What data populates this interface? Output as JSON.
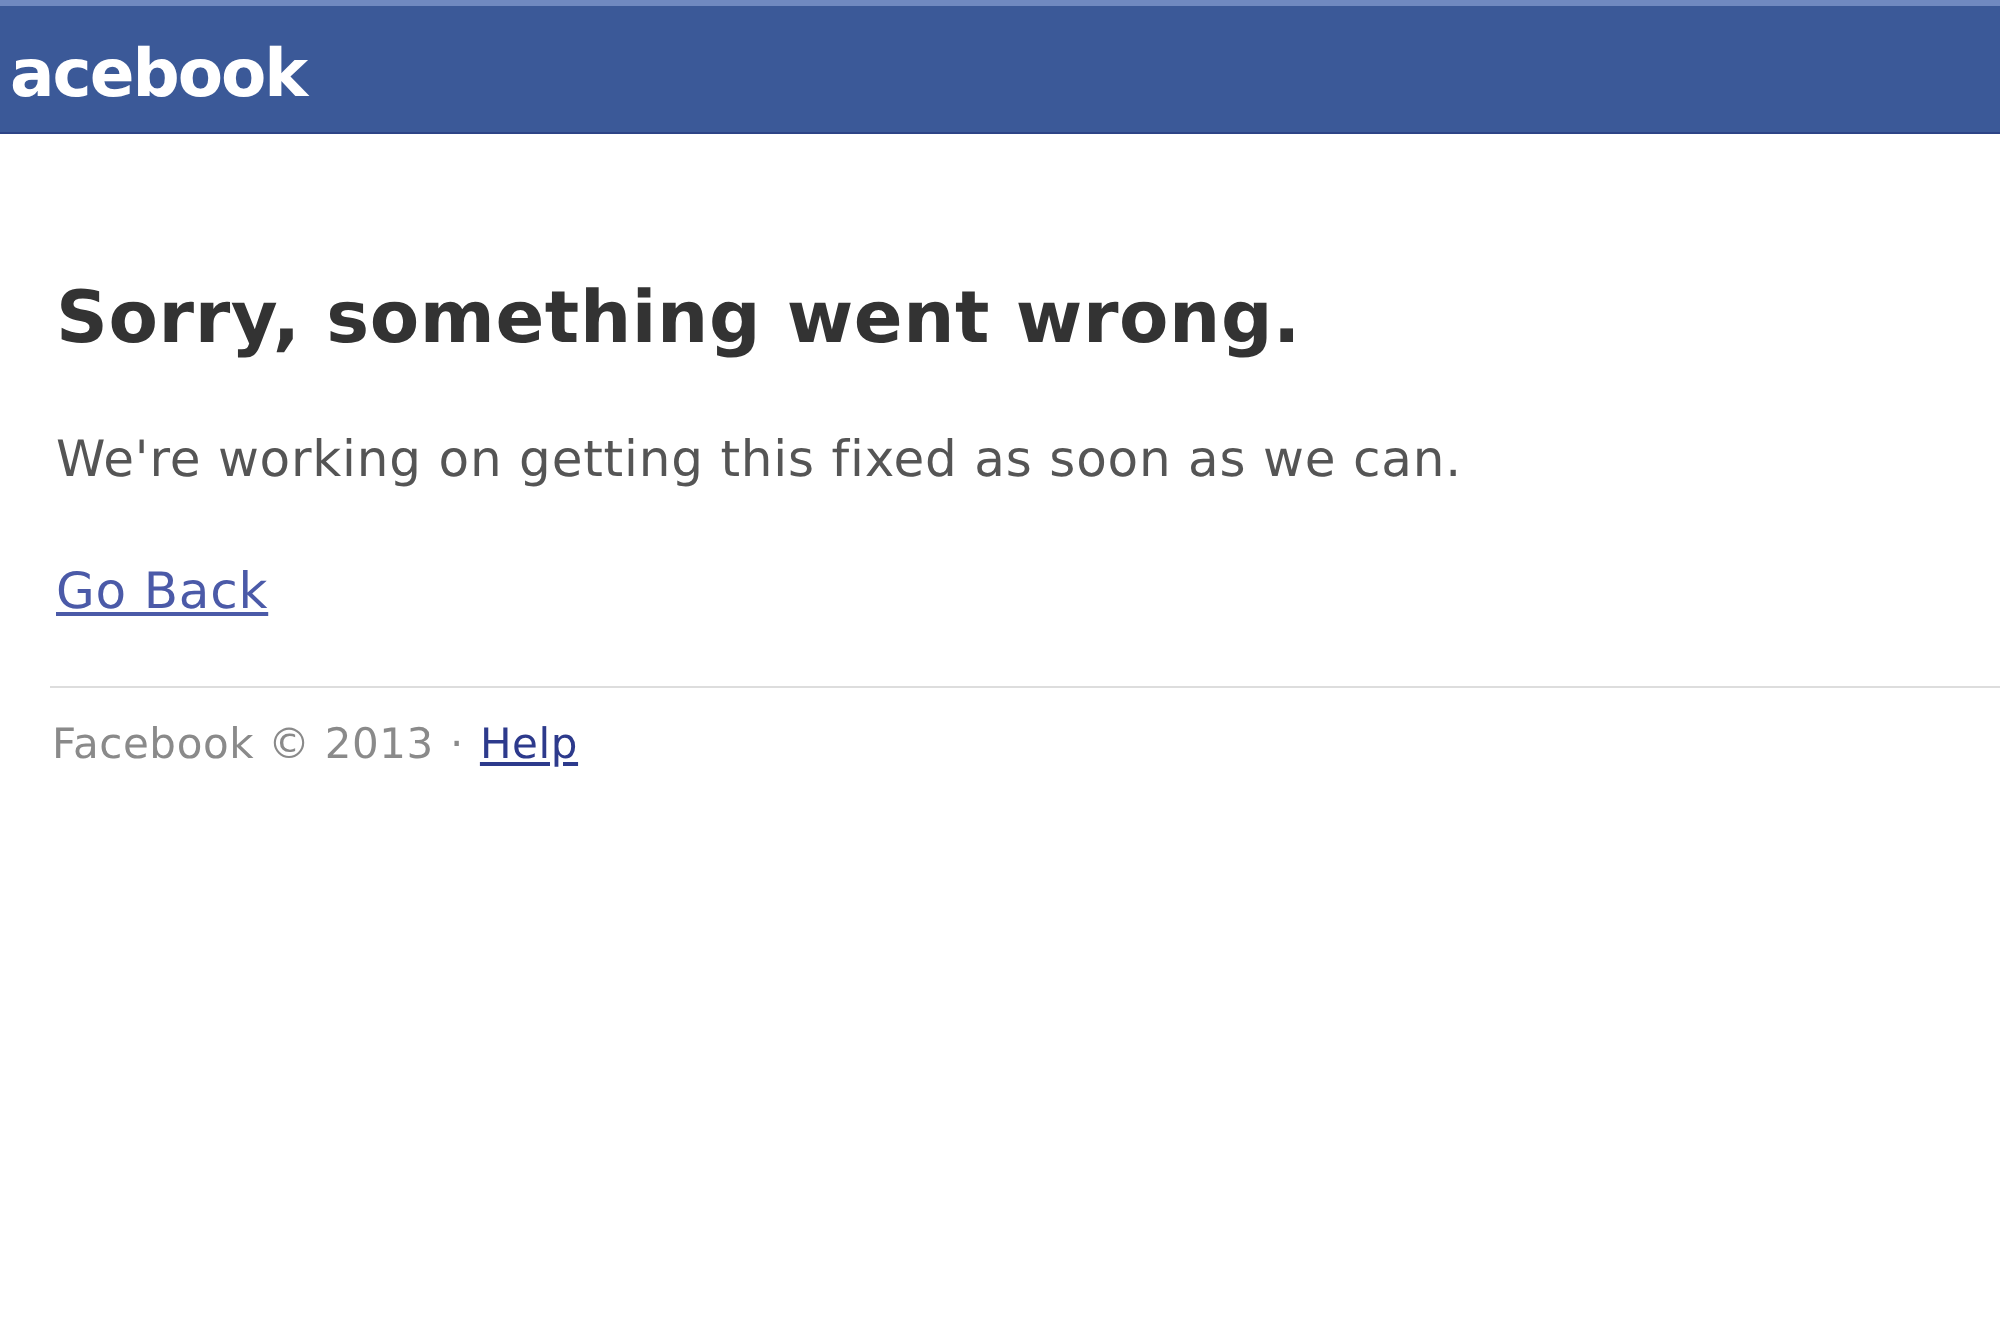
{
  "header": {
    "logo": "acebook"
  },
  "error": {
    "title": "Sorry, something went wrong.",
    "message": "We're working on getting this fixed as soon as we can.",
    "link": "Go Back"
  },
  "footer": {
    "copyright": "Facebook © 2013",
    "separator": "·",
    "link": "Help"
  }
}
